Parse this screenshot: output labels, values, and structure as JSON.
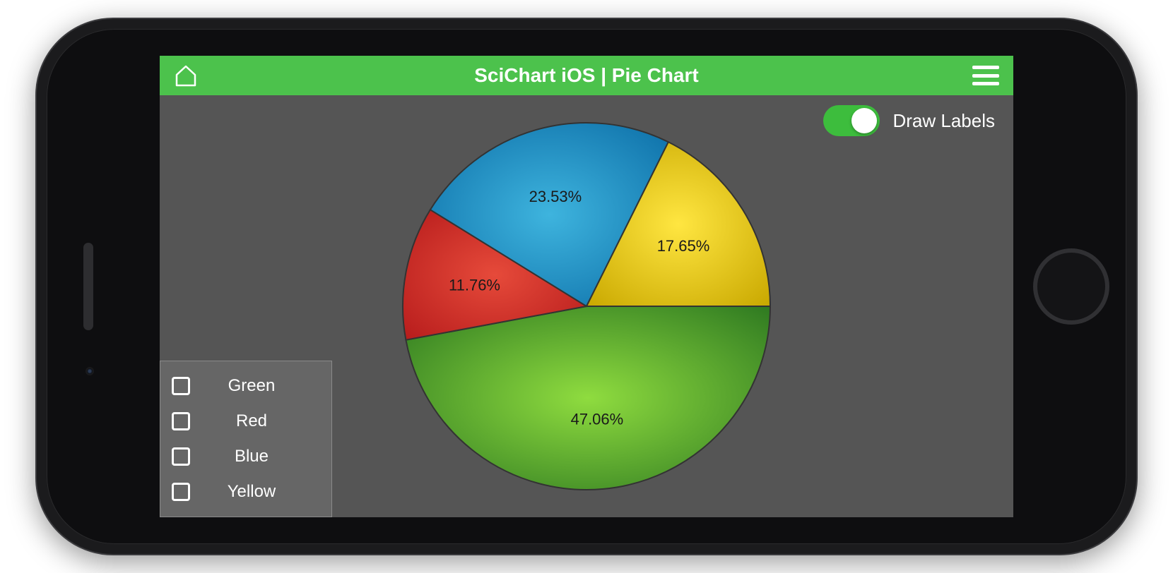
{
  "navbar": {
    "title": "SciChart iOS | Pie Chart"
  },
  "toggle": {
    "label": "Draw Labels",
    "on": true
  },
  "legend": {
    "items": [
      {
        "label": "Green"
      },
      {
        "label": "Red"
      },
      {
        "label": "Blue"
      },
      {
        "label": "Yellow"
      }
    ]
  },
  "colors": {
    "accent": "#4cc24c",
    "screen_bg": "#555555",
    "legend_bg": "#666666",
    "green_start": "#2f7a21",
    "green_end": "#8fdc3f",
    "red_start": "#b71c1c",
    "red_end": "#e64a3a",
    "blue_start": "#0d6fa8",
    "blue_end": "#3eb4de",
    "yellow_start": "#c9a800",
    "yellow_end": "#ffe641"
  },
  "chart_data": {
    "type": "pie",
    "title": "SciChart iOS | Pie Chart",
    "series": [
      {
        "name": "Green",
        "value": 47.06,
        "label": "47.06%",
        "color": "#5aa62a"
      },
      {
        "name": "Red",
        "value": 11.76,
        "label": "11.76%",
        "color": "#d02a1f"
      },
      {
        "name": "Blue",
        "value": 23.53,
        "label": "23.53%",
        "color": "#2190c2"
      },
      {
        "name": "Yellow",
        "value": 17.65,
        "label": "17.65%",
        "color": "#ead400"
      }
    ]
  }
}
